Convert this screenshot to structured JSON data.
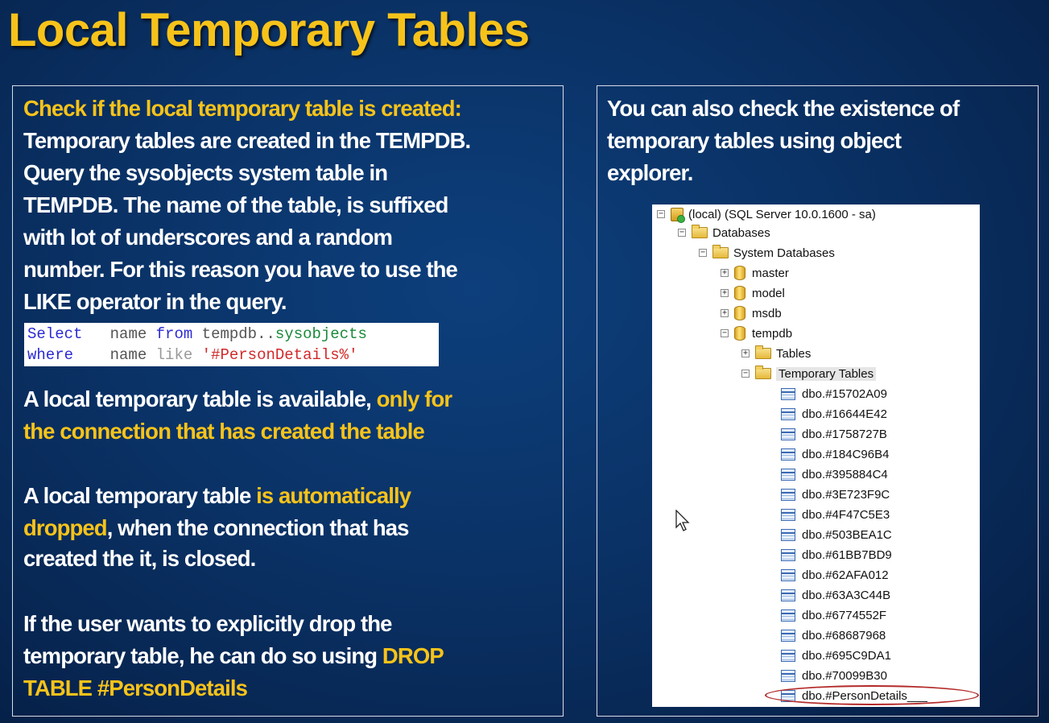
{
  "title": "Local Temporary Tables",
  "left": {
    "heading": "Check if the local temporary table is created:",
    "para1": [
      "Temporary tables are created in the TEMPDB.",
      "Query the sysobjects system table in",
      "TEMPDB. The name of the table, is suffixed",
      "with lot of underscores and a random",
      "number. For this reason you have to use the",
      "LIKE operator in the query."
    ],
    "code": {
      "line1": {
        "kw1": "Select",
        "col": "name",
        "kw2": "from",
        "db": "tempdb..",
        "obj": "sysobjects"
      },
      "line2": {
        "kw1": "where",
        "col": "name",
        "op": "like",
        "str": "'#PersonDetails%'"
      }
    },
    "para2": {
      "white": "A local temporary table is available, ",
      "gold1": "only for",
      "gold2": "the connection that has created the table"
    },
    "para3": {
      "white1": "A local temporary table ",
      "gold1": "is automatically",
      "gold2": "dropped",
      "white2": ", when the connection that has",
      "line3": "created the it, is closed."
    },
    "para4": {
      "line1": "If the user wants to explicitly drop the",
      "white2": "temporary table, he can do so using ",
      "gold2": "DROP",
      "gold3": "TABLE #PersonDetails"
    }
  },
  "right": {
    "lines": [
      "You can also check the existence of",
      "temporary tables using object",
      "explorer."
    ],
    "explorer": {
      "server": "(local) (SQL Server 10.0.1600 - sa)",
      "databases": "Databases",
      "system_databases": "System Databases",
      "dbs": [
        "master",
        "model",
        "msdb",
        "tempdb"
      ],
      "tables": "Tables",
      "temporary_tables": "Temporary Tables",
      "temp_items": [
        "dbo.#15702A09",
        "dbo.#16644E42",
        "dbo.#1758727B",
        "dbo.#184C96B4",
        "dbo.#395884C4",
        "dbo.#3E723F9C",
        "dbo.#4F47C5E3",
        "dbo.#503BEA1C",
        "dbo.#61BB7BD9",
        "dbo.#62AFA012",
        "dbo.#63A3C44B",
        "dbo.#6774552F",
        "dbo.#68687968",
        "dbo.#695C9DA1",
        "dbo.#70099B30"
      ],
      "last_item": "dbo.#PersonDetails___"
    }
  },
  "colors": {
    "accent": "#f7c31a",
    "background": "#0a3266",
    "annotation": "#b42a2a"
  }
}
